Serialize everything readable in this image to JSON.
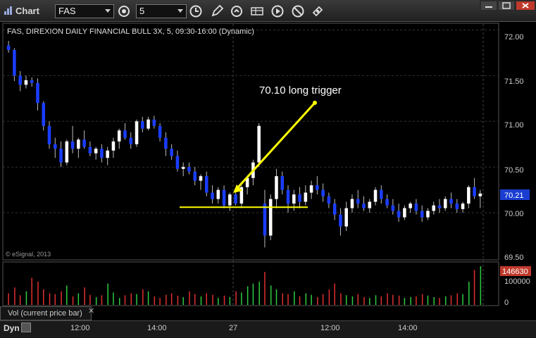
{
  "toolbar": {
    "title": "Chart",
    "symbol_value": "FAS",
    "interval_value": "5"
  },
  "chart": {
    "header": "FAS, DIREXION DAILY FINANCIAL BULL 3X, 5, 09:30-16:00 (Dynamic)",
    "copyright": "© eSignal, 2013",
    "annotation": "70.10 long trigger",
    "price_axis": [
      "72.00",
      "71.50",
      "71.00",
      "70.50",
      "70.00",
      "69.50"
    ],
    "last_price": "70.21",
    "volume_labels": [
      "100000",
      "0"
    ],
    "volume_current": "146630",
    "volume_tab": "Vol (current price bar)",
    "time_axis": [
      "12:00",
      "14:00",
      "27",
      "12:00",
      "14:00"
    ],
    "footer_mode": "Dyn"
  },
  "chart_data": {
    "type": "candlestick",
    "y_range": [
      69.5,
      72.05
    ],
    "trigger_level": 70.06,
    "candles": [
      [
        71.83,
        71.88,
        71.75,
        71.78
      ],
      [
        71.78,
        71.8,
        71.44,
        71.5
      ],
      [
        71.5,
        71.55,
        71.33,
        71.4
      ],
      [
        71.4,
        71.5,
        71.36,
        71.45
      ],
      [
        71.45,
        71.48,
        71.38,
        71.42
      ],
      [
        71.42,
        71.47,
        71.12,
        71.2
      ],
      [
        71.2,
        71.22,
        70.9,
        70.95
      ],
      [
        70.95,
        71.0,
        70.7,
        70.75
      ],
      [
        70.75,
        70.82,
        70.6,
        70.7
      ],
      [
        70.7,
        70.78,
        70.5,
        70.55
      ],
      [
        70.55,
        70.8,
        70.52,
        70.78
      ],
      [
        70.78,
        70.95,
        70.65,
        70.7
      ],
      [
        70.7,
        70.82,
        70.6,
        70.8
      ],
      [
        70.8,
        70.9,
        70.7,
        70.72
      ],
      [
        70.72,
        70.78,
        70.62,
        70.65
      ],
      [
        70.65,
        70.72,
        70.58,
        70.7
      ],
      [
        70.7,
        70.75,
        70.55,
        70.6
      ],
      [
        70.6,
        70.72,
        70.52,
        70.68
      ],
      [
        70.68,
        70.82,
        70.6,
        70.78
      ],
      [
        70.78,
        70.92,
        70.7,
        70.9
      ],
      [
        70.9,
        70.98,
        70.8,
        70.82
      ],
      [
        70.82,
        70.88,
        70.7,
        70.75
      ],
      [
        70.75,
        71.02,
        70.72,
        71.0
      ],
      [
        71.0,
        71.05,
        70.88,
        70.92
      ],
      [
        70.92,
        71.05,
        70.9,
        71.02
      ],
      [
        71.02,
        71.06,
        70.92,
        70.95
      ],
      [
        70.95,
        70.98,
        70.78,
        70.82
      ],
      [
        70.82,
        70.88,
        70.62,
        70.7
      ],
      [
        70.7,
        70.75,
        70.58,
        70.62
      ],
      [
        70.62,
        70.68,
        70.45,
        70.48
      ],
      [
        70.48,
        70.55,
        70.4,
        70.5
      ],
      [
        70.5,
        70.55,
        70.42,
        70.45
      ],
      [
        70.45,
        70.5,
        70.3,
        70.35
      ],
      [
        70.35,
        70.42,
        70.25,
        70.4
      ],
      [
        70.4,
        70.45,
        70.18,
        70.22
      ],
      [
        70.22,
        70.3,
        70.1,
        70.15
      ],
      [
        70.15,
        70.28,
        70.1,
        70.25
      ],
      [
        70.25,
        70.3,
        70.05,
        70.08
      ],
      [
        70.08,
        70.22,
        70.02,
        70.2
      ],
      [
        70.2,
        70.25,
        70.08,
        70.1
      ],
      [
        70.1,
        70.3,
        70.05,
        70.28
      ],
      [
        70.28,
        70.4,
        70.2,
        70.38
      ],
      [
        70.38,
        70.58,
        70.3,
        70.55
      ],
      [
        70.55,
        70.98,
        70.5,
        70.95
      ],
      [
        70.1,
        70.25,
        69.62,
        69.75
      ],
      [
        69.75,
        70.2,
        69.7,
        70.15
      ],
      [
        70.15,
        70.48,
        70.05,
        70.4
      ],
      [
        70.4,
        70.45,
        70.2,
        70.25
      ],
      [
        70.25,
        70.3,
        70.0,
        70.1
      ],
      [
        70.1,
        70.25,
        70.02,
        70.2
      ],
      [
        70.2,
        70.28,
        70.05,
        70.12
      ],
      [
        70.12,
        70.3,
        70.08,
        70.22
      ],
      [
        70.22,
        70.35,
        70.15,
        70.3
      ],
      [
        70.3,
        70.4,
        70.2,
        70.25
      ],
      [
        70.25,
        70.32,
        70.12,
        70.18
      ],
      [
        70.18,
        70.22,
        70.05,
        70.1
      ],
      [
        70.1,
        70.15,
        69.92,
        69.98
      ],
      [
        69.98,
        70.05,
        69.75,
        69.85
      ],
      [
        69.85,
        70.12,
        69.8,
        70.05
      ],
      [
        70.05,
        70.2,
        70.0,
        70.15
      ],
      [
        70.15,
        70.25,
        70.05,
        70.1
      ],
      [
        70.1,
        70.18,
        70.02,
        70.05
      ],
      [
        70.05,
        70.15,
        70.0,
        70.12
      ],
      [
        70.12,
        70.28,
        70.08,
        70.25
      ],
      [
        70.25,
        70.3,
        70.1,
        70.15
      ],
      [
        70.15,
        70.2,
        70.05,
        70.08
      ],
      [
        70.08,
        70.15,
        69.98,
        70.02
      ],
      [
        70.02,
        70.1,
        69.9,
        69.95
      ],
      [
        69.95,
        70.08,
        69.92,
        70.05
      ],
      [
        70.05,
        70.12,
        70.0,
        70.1
      ],
      [
        70.1,
        70.15,
        69.98,
        70.02
      ],
      [
        70.02,
        70.08,
        69.9,
        69.95
      ],
      [
        69.95,
        70.05,
        69.92,
        70.02
      ],
      [
        70.02,
        70.12,
        69.98,
        70.08
      ],
      [
        70.08,
        70.15,
        70.0,
        70.05
      ],
      [
        70.05,
        70.18,
        70.02,
        70.15
      ],
      [
        70.15,
        70.22,
        70.05,
        70.1
      ],
      [
        70.1,
        70.15,
        70.0,
        70.04
      ],
      [
        70.04,
        70.12,
        70.0,
        70.1
      ],
      [
        70.1,
        70.3,
        70.05,
        70.28
      ],
      [
        70.28,
        70.38,
        70.15,
        70.18
      ],
      [
        70.18,
        70.25,
        70.05,
        70.21
      ]
    ],
    "volume": [
      30,
      45,
      25,
      35,
      70,
      60,
      40,
      30,
      28,
      35,
      50,
      22,
      30,
      45,
      26,
      20,
      25,
      55,
      32,
      18,
      25,
      30,
      28,
      40,
      35,
      22,
      18,
      26,
      30,
      24,
      20,
      35,
      28,
      22,
      30,
      26,
      18,
      24,
      20,
      35,
      32,
      48,
      55,
      60,
      85,
      50,
      40,
      30,
      28,
      35,
      22,
      30,
      26,
      20,
      28,
      40,
      55,
      30,
      25,
      22,
      28,
      20,
      18,
      25,
      22,
      30,
      26,
      24,
      18,
      20,
      22,
      28,
      24,
      20,
      18,
      22,
      25,
      30,
      28,
      60,
      90,
      100
    ]
  }
}
